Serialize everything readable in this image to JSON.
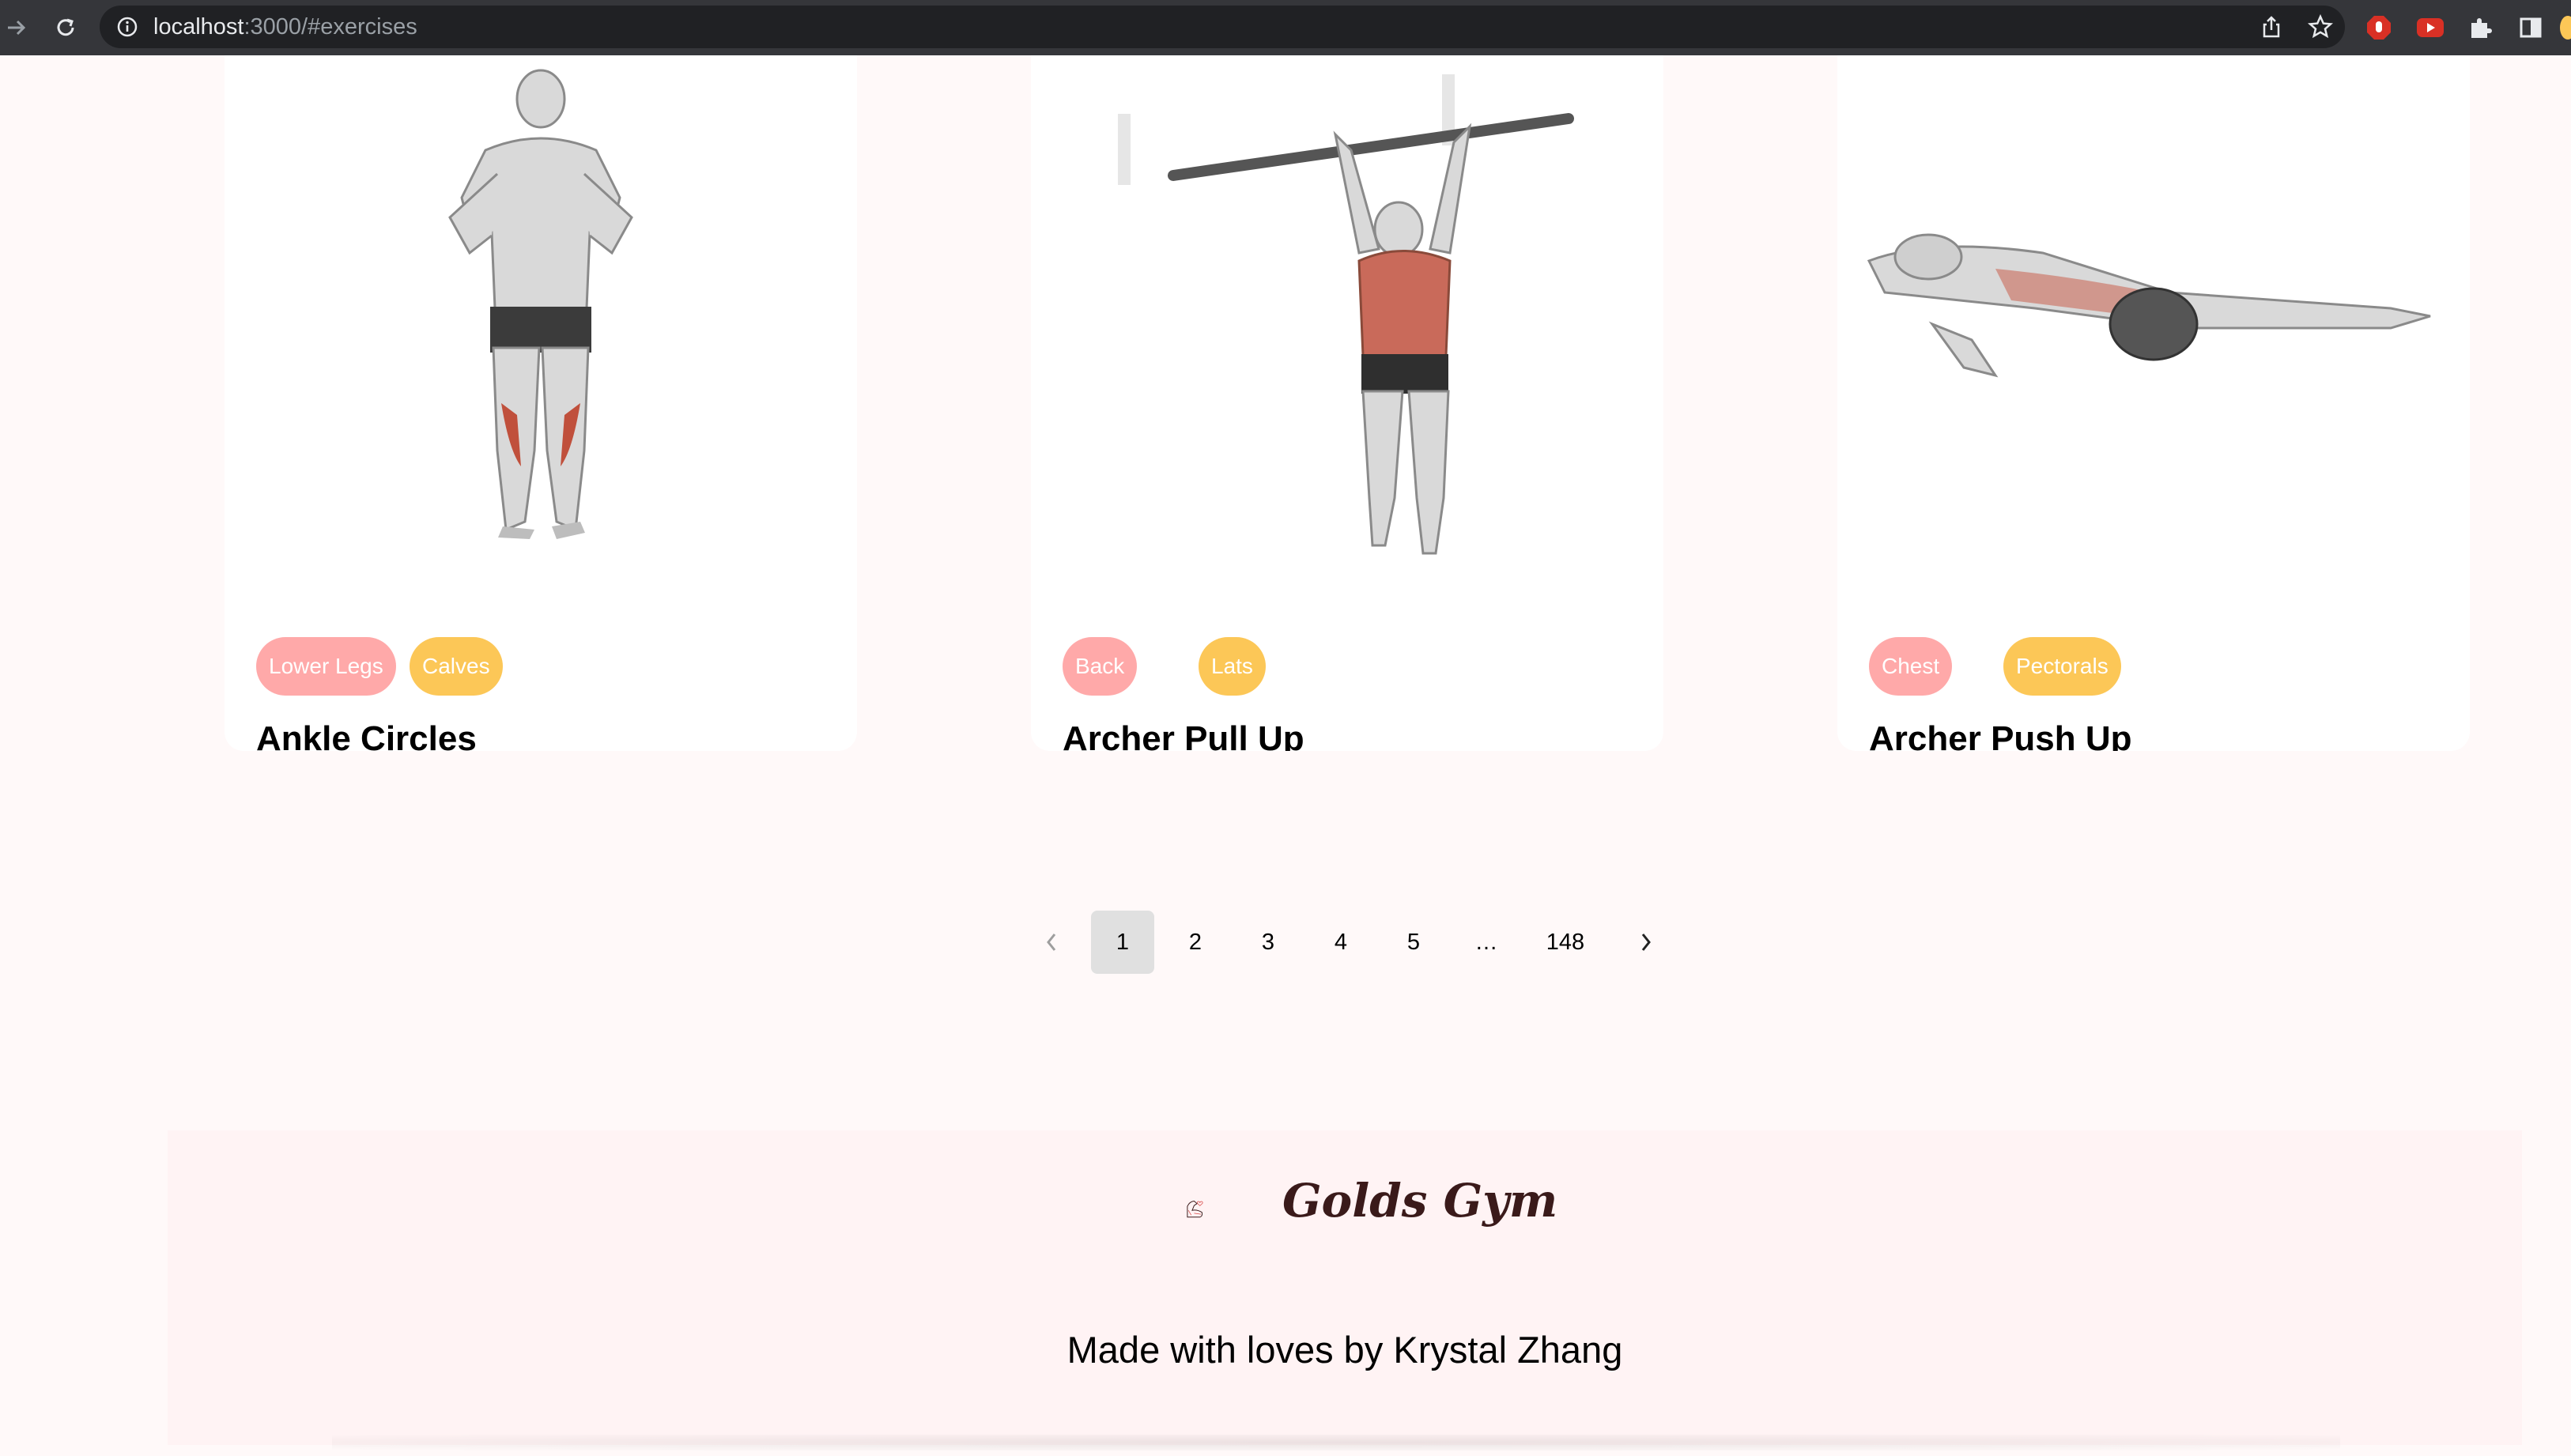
{
  "browser": {
    "url_host": "localhost",
    "url_rest": ":3000/#exercises",
    "icons": [
      "forward-arrow-icon",
      "reload-icon",
      "info-icon",
      "share-icon",
      "bookmark-star-icon",
      "adblock-icon",
      "youtube-extension-icon",
      "extensions-puzzle-icon",
      "side-panel-icon"
    ]
  },
  "exercises": [
    {
      "name": "Ankle Circles",
      "body_part": "Lower Legs",
      "target": "Calves"
    },
    {
      "name": "Archer Pull Up",
      "body_part": "Back",
      "target": "Lats"
    },
    {
      "name": "Archer Push Up",
      "body_part": "Chest",
      "target": "Pectorals"
    }
  ],
  "pagination": {
    "current_page": "1",
    "pages": [
      "1",
      "2",
      "3",
      "4",
      "5"
    ],
    "ellipsis": "…",
    "last_page": "148",
    "prev_icon": "chevron-left-icon",
    "next_icon": "chevron-right-icon"
  },
  "footer": {
    "brand": "Golds Gym",
    "credit": "Made with loves by Krystal Zhang"
  },
  "colors": {
    "page_bg": "#fff9f9",
    "tag_body_part": "#ffa9a9",
    "tag_target": "#fcc757",
    "footer_bg": "#fff3f4"
  }
}
